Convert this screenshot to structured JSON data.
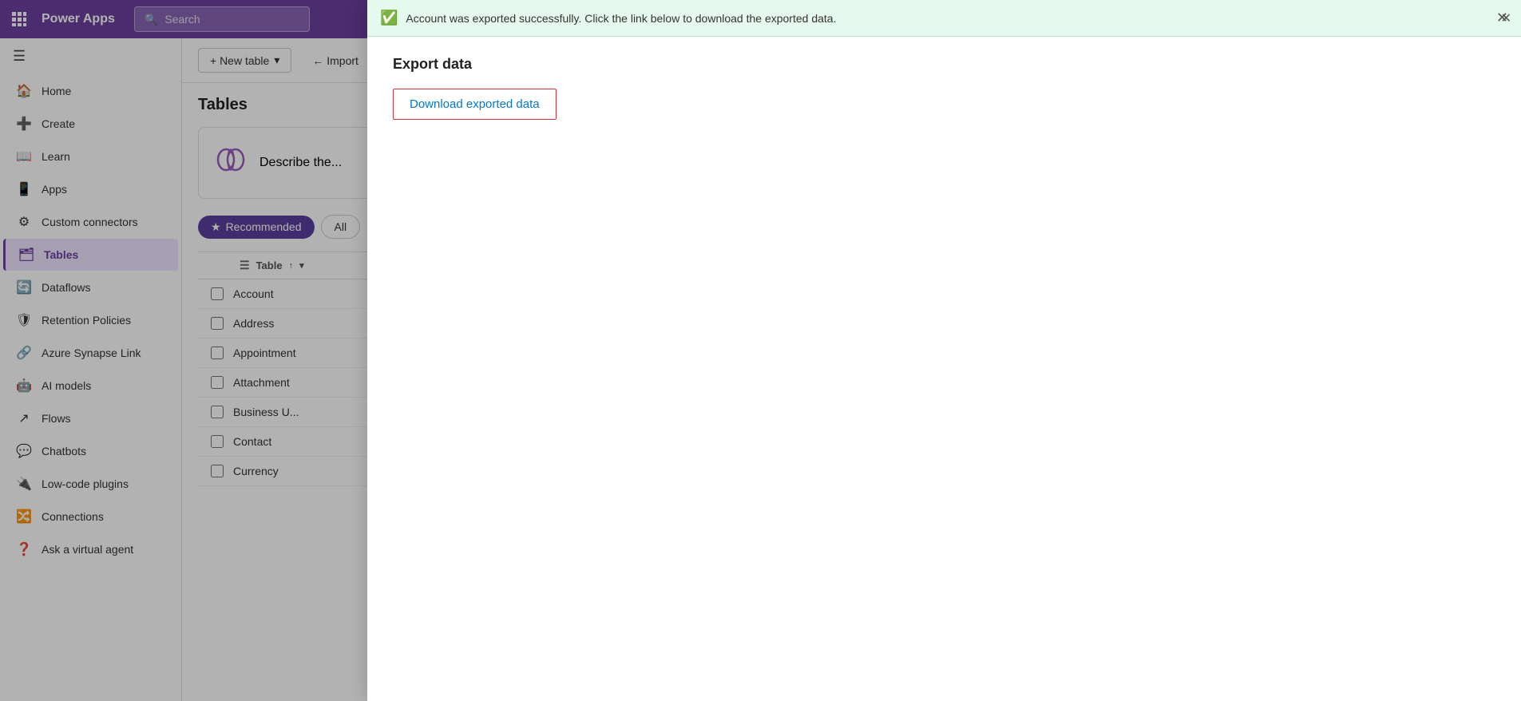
{
  "topbar": {
    "title": "Power Apps",
    "search_placeholder": "Search"
  },
  "sidebar": {
    "items": [
      {
        "id": "home",
        "label": "Home",
        "icon": "🏠"
      },
      {
        "id": "create",
        "label": "Create",
        "icon": "➕"
      },
      {
        "id": "learn",
        "label": "Learn",
        "icon": "📖"
      },
      {
        "id": "apps",
        "label": "Apps",
        "icon": "📱"
      },
      {
        "id": "custom-connectors",
        "label": "Custom connectors",
        "icon": "⚙"
      },
      {
        "id": "tables",
        "label": "Tables",
        "icon": "🗂",
        "active": true
      },
      {
        "id": "dataflows",
        "label": "Dataflows",
        "icon": "🔄"
      },
      {
        "id": "retention-policies",
        "label": "Retention Policies",
        "icon": "🛡"
      },
      {
        "id": "azure-synapse",
        "label": "Azure Synapse Link",
        "icon": "🔗"
      },
      {
        "id": "ai-models",
        "label": "AI models",
        "icon": "🤖"
      },
      {
        "id": "flows",
        "label": "Flows",
        "icon": "↗"
      },
      {
        "id": "chatbots",
        "label": "Chatbots",
        "icon": "💬"
      },
      {
        "id": "low-code",
        "label": "Low-code plugins",
        "icon": "🔌"
      },
      {
        "id": "connections",
        "label": "Connections",
        "icon": "🔀"
      },
      {
        "id": "ask-agent",
        "label": "Ask a virtual agent",
        "icon": "❓"
      }
    ]
  },
  "toolbar": {
    "new_table_label": "+ New table",
    "import_label": "← Import"
  },
  "tables_section": {
    "title": "Tables",
    "ai_card_text": "Describe the...",
    "filter_tabs": [
      {
        "id": "recommended",
        "label": "Recommended",
        "active": true
      },
      {
        "id": "all",
        "label": "All"
      }
    ],
    "table_column_label": "Table",
    "rows": [
      {
        "name": "Account"
      },
      {
        "name": "Address"
      },
      {
        "name": "Appointment"
      },
      {
        "name": "Attachment"
      },
      {
        "name": "Business U..."
      },
      {
        "name": "Contact"
      },
      {
        "name": "Currency"
      }
    ]
  },
  "success_banner": {
    "text": "Account was exported successfully. Click the link below to download the exported data.",
    "close_label": "✕"
  },
  "export_panel": {
    "title": "Export data",
    "download_label": "Download exported data",
    "modal_close_label": "✕"
  }
}
